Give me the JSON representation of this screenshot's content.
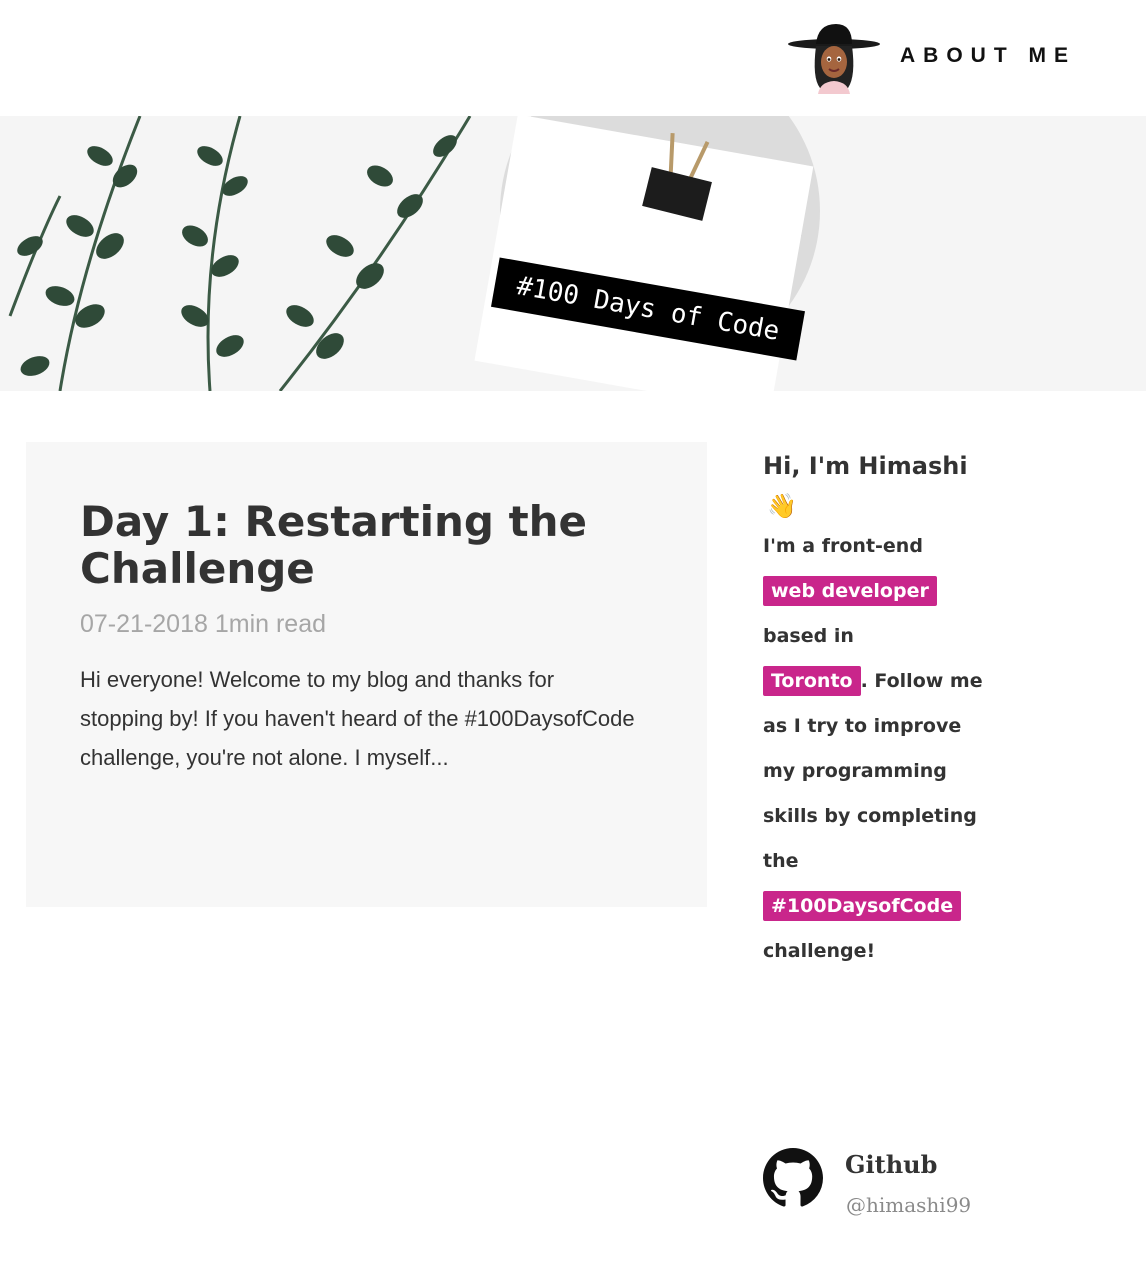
{
  "header": {
    "nav_about": "ABOUT ME"
  },
  "hero": {
    "banner_text": "#100 Days of Code"
  },
  "post": {
    "title": "Day 1: Restarting the Challenge",
    "date": "07-21-2018",
    "read_time": "1min read",
    "excerpt": "Hi everyone! Welcome to my blog and thanks for stopping by! If you haven't heard of the #100DaysofCode challenge, you're not alone. I myself..."
  },
  "sidebar": {
    "greeting": "Hi, I'm Himashi",
    "wave_emoji": "👋",
    "intro_1": "I'm a front-end",
    "highlight_role": "web developer",
    "intro_2": "based in",
    "highlight_city": "Toronto",
    "intro_3": ". Follow me as I try to improve my programming skills by completing the",
    "highlight_challenge": "#100DaysofCode",
    "intro_4": "challenge!"
  },
  "social": {
    "github_label": "Github",
    "github_handle": "@himashi99"
  },
  "colors": {
    "highlight": "#c9268b",
    "card_bg": "#f7f7f7",
    "meta_gray": "#a6a6a6"
  },
  "icons": [
    "avatar",
    "wave-icon",
    "github-icon"
  ]
}
